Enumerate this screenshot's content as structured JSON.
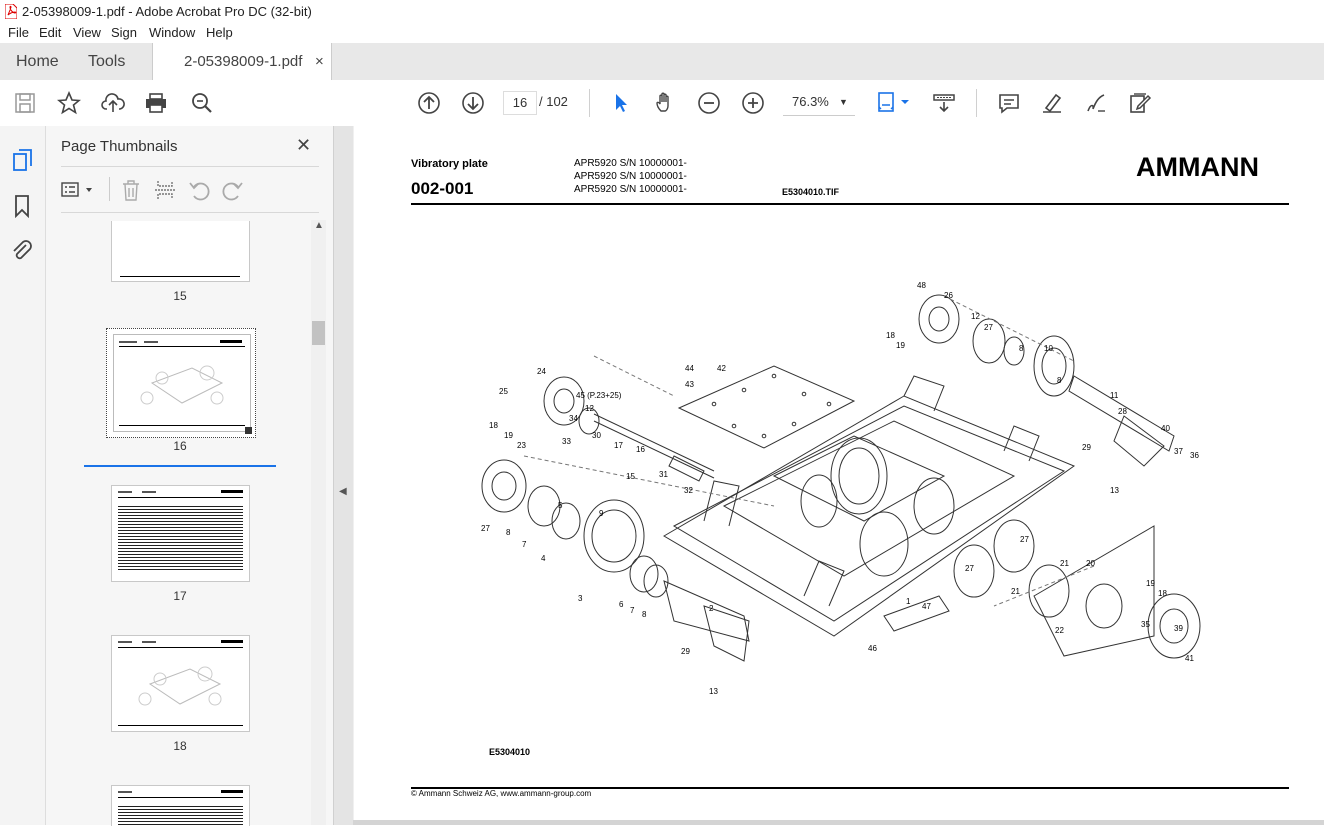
{
  "window": {
    "title": "2-05398009-1.pdf - Adobe Acrobat Pro DC (32-bit)"
  },
  "menu": [
    "File",
    "Edit",
    "View",
    "Sign",
    "Window",
    "Help"
  ],
  "tabs": {
    "home": "Home",
    "tools": "Tools",
    "document": "2-05398009-1.pdf",
    "close": "×"
  },
  "toolbar": {
    "page_current": "16",
    "page_total": "/ 102",
    "zoom": "76.3%",
    "icons": [
      "save-icon",
      "star-icon",
      "upload-icon",
      "print-icon",
      "zoom-search-icon",
      "page-up-icon",
      "page-down-icon",
      "select-cursor-icon",
      "hand-icon",
      "zoom-out-icon",
      "zoom-in-icon",
      "page-fit-icon",
      "scroll-mode-icon",
      "comment-icon",
      "highlight-icon",
      "sign-icon",
      "edit-share-icon"
    ]
  },
  "rail": {
    "icons": [
      "page-thumbnails-icon",
      "bookmark-icon",
      "attachment-icon"
    ]
  },
  "thumbnails": {
    "title": "Page Thumbnails",
    "close": "✕",
    "pages": [
      "15",
      "16",
      "17",
      "18"
    ]
  },
  "document": {
    "header_label": "Vibratory plate",
    "header_code": "002-001",
    "models": [
      "APR5920 S/N 10000001-",
      "APR5920 S/N 10000001-",
      "APR5920 S/N 10000001-"
    ],
    "tif": "E5304010.TIF",
    "brand": "AMMANN",
    "drawing_code": "E5304010",
    "footer": "© Ammann Schweiz AG, www.ammann-group.com",
    "callouts": [
      "48",
      "26",
      "12",
      "27",
      "18",
      "19",
      "10",
      "8",
      "44",
      "42",
      "43",
      "24",
      "25",
      "45 (P.23+25)",
      "12",
      "18",
      "19",
      "23",
      "34",
      "33",
      "30",
      "17",
      "16",
      "15",
      "31",
      "32",
      "11",
      "28",
      "40",
      "29",
      "37",
      "36",
      "13",
      "5",
      "9",
      "27",
      "8",
      "7",
      "4",
      "3",
      "6",
      "7",
      "8",
      "2",
      "29",
      "13",
      "1",
      "47",
      "46",
      "27",
      "27",
      "21",
      "20",
      "21",
      "19",
      "18",
      "22",
      "35",
      "39",
      "41"
    ]
  }
}
